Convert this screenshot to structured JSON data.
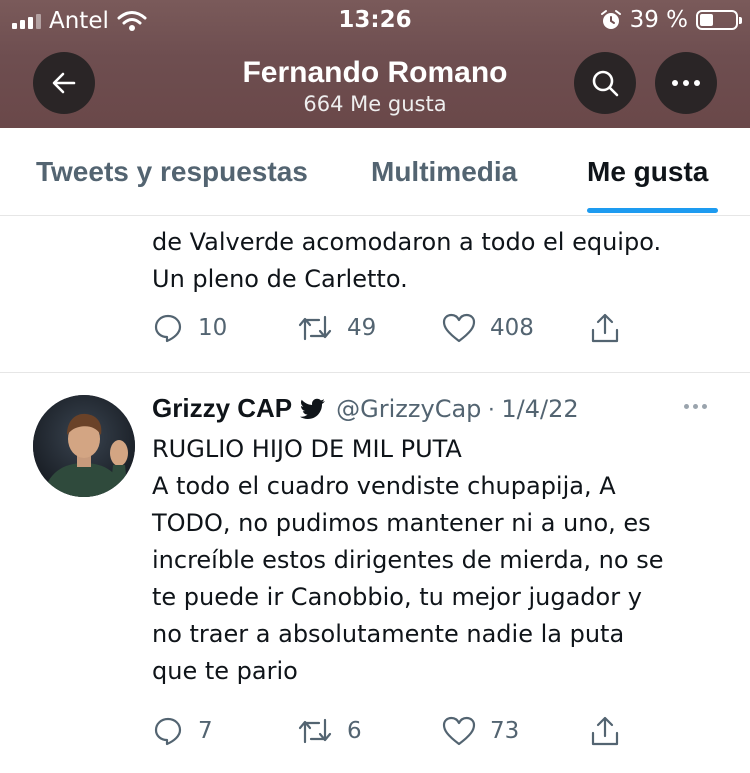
{
  "status_bar": {
    "carrier": "Antel",
    "time": "13:26",
    "battery": "39 %"
  },
  "header": {
    "name": "Fernando Romano",
    "subtitle": "664 Me gusta",
    "icons": {
      "back": "arrow-left-icon",
      "search": "search-icon",
      "more": "more-horizontal-icon"
    }
  },
  "tabs": [
    {
      "label": "Tweets y respuestas",
      "active": false
    },
    {
      "label": "Multimedia",
      "active": false
    },
    {
      "label": "Me gusta",
      "active": true
    }
  ],
  "tweets": [
    {
      "lines": [
        "de Valverde acomodaron a todo el equipo.",
        "Un pleno de Carletto."
      ],
      "replies": "10",
      "retweets": "49",
      "likes": "408"
    },
    {
      "name": "Grizzy CAP",
      "handle": "@GrizzyCap",
      "separator": "·",
      "date": "1/4/22",
      "lines": [
        "RUGLIO HIJO DE MIL PUTA",
        "A todo el cuadro vendiste chupapija, A",
        "TODO, no pudimos mantener ni a uno, es",
        "increíble estos dirigentes de mierda, no se",
        "te puede ir Canobbio, tu mejor jugador y",
        "no traer a absolutamente nadie la puta",
        "que te pario"
      ],
      "replies": "7",
      "retweets": "6",
      "likes": "73"
    }
  ],
  "colors": {
    "accent": "#1d9bf0",
    "header_bg": "#6e4e50",
    "muted": "#536471"
  }
}
